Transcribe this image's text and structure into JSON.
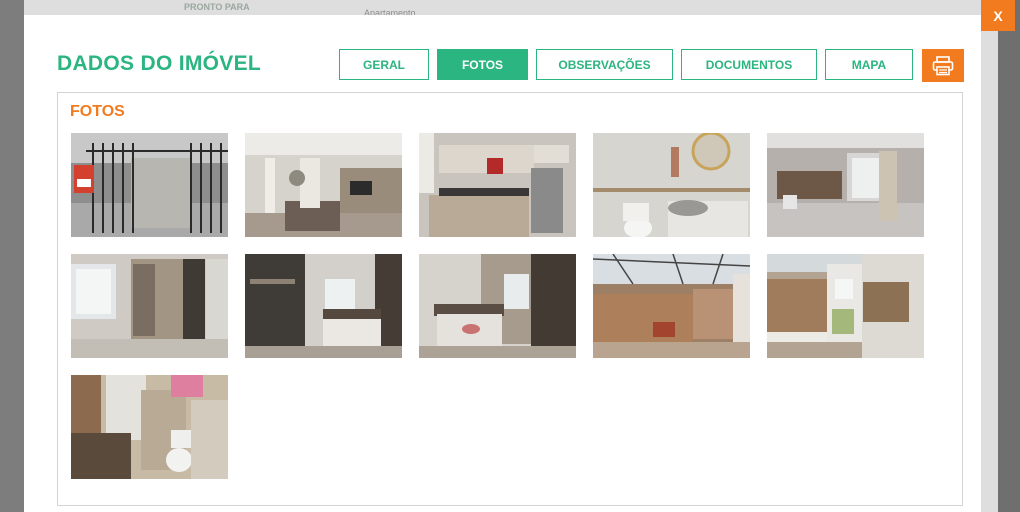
{
  "background": {
    "status_text": "PRONTO PARA",
    "type_text": "Apartamento"
  },
  "modal": {
    "title": "DADOS DO IMÓVEL",
    "close_label": "X",
    "tabs": [
      {
        "label": "GERAL",
        "active": false
      },
      {
        "label": "FOTOS",
        "active": true
      },
      {
        "label": "OBSERVAÇÕES",
        "active": false
      },
      {
        "label": "DOCUMENTOS",
        "active": false
      },
      {
        "label": "MAPA",
        "active": false
      }
    ],
    "print_icon": "printer-icon",
    "section_title": "FOTOS",
    "photos": [
      {
        "subject": "gated-entrance"
      },
      {
        "subject": "living-room-stairs"
      },
      {
        "subject": "kitchen"
      },
      {
        "subject": "bathroom-sink"
      },
      {
        "subject": "empty-room"
      },
      {
        "subject": "bedroom-wardrobe"
      },
      {
        "subject": "bedroom-double-bed"
      },
      {
        "subject": "bedroom-single-bed"
      },
      {
        "subject": "patio-brick-wall"
      },
      {
        "subject": "patio-covered"
      },
      {
        "subject": "bathroom-toilet"
      }
    ]
  },
  "colors": {
    "accent_green": "#2bb580",
    "accent_orange": "#f27b1f"
  }
}
